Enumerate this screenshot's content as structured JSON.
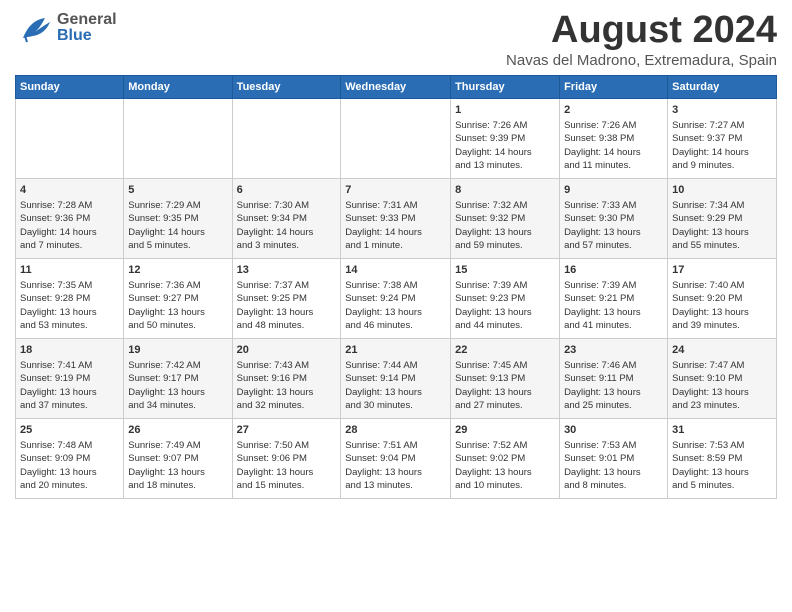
{
  "header": {
    "logo_general": "General",
    "logo_blue": "Blue",
    "title": "August 2024",
    "subtitle": "Navas del Madrono, Extremadura, Spain"
  },
  "weekdays": [
    "Sunday",
    "Monday",
    "Tuesday",
    "Wednesday",
    "Thursday",
    "Friday",
    "Saturday"
  ],
  "weeks": [
    [
      {
        "day": "",
        "content": ""
      },
      {
        "day": "",
        "content": ""
      },
      {
        "day": "",
        "content": ""
      },
      {
        "day": "",
        "content": ""
      },
      {
        "day": "1",
        "content": "Sunrise: 7:26 AM\nSunset: 9:39 PM\nDaylight: 14 hours\nand 13 minutes."
      },
      {
        "day": "2",
        "content": "Sunrise: 7:26 AM\nSunset: 9:38 PM\nDaylight: 14 hours\nand 11 minutes."
      },
      {
        "day": "3",
        "content": "Sunrise: 7:27 AM\nSunset: 9:37 PM\nDaylight: 14 hours\nand 9 minutes."
      }
    ],
    [
      {
        "day": "4",
        "content": "Sunrise: 7:28 AM\nSunset: 9:36 PM\nDaylight: 14 hours\nand 7 minutes."
      },
      {
        "day": "5",
        "content": "Sunrise: 7:29 AM\nSunset: 9:35 PM\nDaylight: 14 hours\nand 5 minutes."
      },
      {
        "day": "6",
        "content": "Sunrise: 7:30 AM\nSunset: 9:34 PM\nDaylight: 14 hours\nand 3 minutes."
      },
      {
        "day": "7",
        "content": "Sunrise: 7:31 AM\nSunset: 9:33 PM\nDaylight: 14 hours\nand 1 minute."
      },
      {
        "day": "8",
        "content": "Sunrise: 7:32 AM\nSunset: 9:32 PM\nDaylight: 13 hours\nand 59 minutes."
      },
      {
        "day": "9",
        "content": "Sunrise: 7:33 AM\nSunset: 9:30 PM\nDaylight: 13 hours\nand 57 minutes."
      },
      {
        "day": "10",
        "content": "Sunrise: 7:34 AM\nSunset: 9:29 PM\nDaylight: 13 hours\nand 55 minutes."
      }
    ],
    [
      {
        "day": "11",
        "content": "Sunrise: 7:35 AM\nSunset: 9:28 PM\nDaylight: 13 hours\nand 53 minutes."
      },
      {
        "day": "12",
        "content": "Sunrise: 7:36 AM\nSunset: 9:27 PM\nDaylight: 13 hours\nand 50 minutes."
      },
      {
        "day": "13",
        "content": "Sunrise: 7:37 AM\nSunset: 9:25 PM\nDaylight: 13 hours\nand 48 minutes."
      },
      {
        "day": "14",
        "content": "Sunrise: 7:38 AM\nSunset: 9:24 PM\nDaylight: 13 hours\nand 46 minutes."
      },
      {
        "day": "15",
        "content": "Sunrise: 7:39 AM\nSunset: 9:23 PM\nDaylight: 13 hours\nand 44 minutes."
      },
      {
        "day": "16",
        "content": "Sunrise: 7:39 AM\nSunset: 9:21 PM\nDaylight: 13 hours\nand 41 minutes."
      },
      {
        "day": "17",
        "content": "Sunrise: 7:40 AM\nSunset: 9:20 PM\nDaylight: 13 hours\nand 39 minutes."
      }
    ],
    [
      {
        "day": "18",
        "content": "Sunrise: 7:41 AM\nSunset: 9:19 PM\nDaylight: 13 hours\nand 37 minutes."
      },
      {
        "day": "19",
        "content": "Sunrise: 7:42 AM\nSunset: 9:17 PM\nDaylight: 13 hours\nand 34 minutes."
      },
      {
        "day": "20",
        "content": "Sunrise: 7:43 AM\nSunset: 9:16 PM\nDaylight: 13 hours\nand 32 minutes."
      },
      {
        "day": "21",
        "content": "Sunrise: 7:44 AM\nSunset: 9:14 PM\nDaylight: 13 hours\nand 30 minutes."
      },
      {
        "day": "22",
        "content": "Sunrise: 7:45 AM\nSunset: 9:13 PM\nDaylight: 13 hours\nand 27 minutes."
      },
      {
        "day": "23",
        "content": "Sunrise: 7:46 AM\nSunset: 9:11 PM\nDaylight: 13 hours\nand 25 minutes."
      },
      {
        "day": "24",
        "content": "Sunrise: 7:47 AM\nSunset: 9:10 PM\nDaylight: 13 hours\nand 23 minutes."
      }
    ],
    [
      {
        "day": "25",
        "content": "Sunrise: 7:48 AM\nSunset: 9:09 PM\nDaylight: 13 hours\nand 20 minutes."
      },
      {
        "day": "26",
        "content": "Sunrise: 7:49 AM\nSunset: 9:07 PM\nDaylight: 13 hours\nand 18 minutes."
      },
      {
        "day": "27",
        "content": "Sunrise: 7:50 AM\nSunset: 9:06 PM\nDaylight: 13 hours\nand 15 minutes."
      },
      {
        "day": "28",
        "content": "Sunrise: 7:51 AM\nSunset: 9:04 PM\nDaylight: 13 hours\nand 13 minutes."
      },
      {
        "day": "29",
        "content": "Sunrise: 7:52 AM\nSunset: 9:02 PM\nDaylight: 13 hours\nand 10 minutes."
      },
      {
        "day": "30",
        "content": "Sunrise: 7:53 AM\nSunset: 9:01 PM\nDaylight: 13 hours\nand 8 minutes."
      },
      {
        "day": "31",
        "content": "Sunrise: 7:53 AM\nSunset: 8:59 PM\nDaylight: 13 hours\nand 5 minutes."
      }
    ]
  ]
}
